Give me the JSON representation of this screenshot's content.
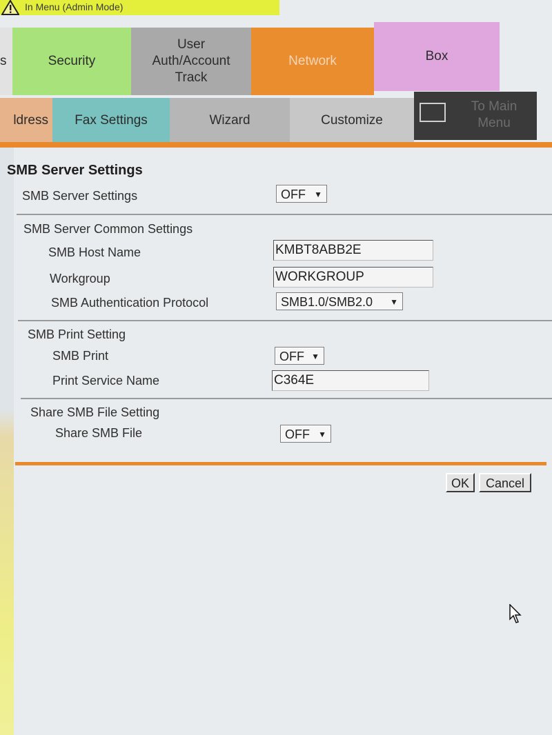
{
  "banner": {
    "text": "In Menu (Admin Mode)",
    "icon": "warning-icon"
  },
  "tabs_row1": {
    "left_partial": "s",
    "security": "Security",
    "user": "User\nAuth/Account\nTrack",
    "network": "Network",
    "box": "Box"
  },
  "tabs_row2": {
    "address_partial": "ldress",
    "fax": "Fax Settings",
    "wizard": "Wizard",
    "customize": "Customize",
    "main_menu": "To Main\nMenu"
  },
  "form": {
    "title": "SMB Server Settings",
    "smb_server_label": "SMB Server Settings",
    "smb_server_value": "OFF",
    "common_heading": "SMB Server Common Settings",
    "host_label": "SMB Host Name",
    "host_value": "KMBT8ABB2E",
    "workgroup_label": "Workgroup",
    "workgroup_value": "WORKGROUP",
    "auth_label": "SMB Authentication Protocol",
    "auth_value": "SMB1.0/SMB2.0",
    "print_heading": "SMB Print Setting",
    "print_label": "SMB Print",
    "print_value": "OFF",
    "service_label": "Print Service Name",
    "service_value": "C364E",
    "share_heading": "Share SMB File Setting",
    "share_label": "Share SMB File",
    "share_value": "OFF"
  },
  "buttons": {
    "ok": "OK",
    "cancel": "Cancel"
  },
  "colors": {
    "banner": "#e4ef3c",
    "security": "#a8e27a",
    "network": "#ea8d2f",
    "box": "#e0a7df",
    "fax": "#79c2c0",
    "accent_line": "#e9892c"
  }
}
